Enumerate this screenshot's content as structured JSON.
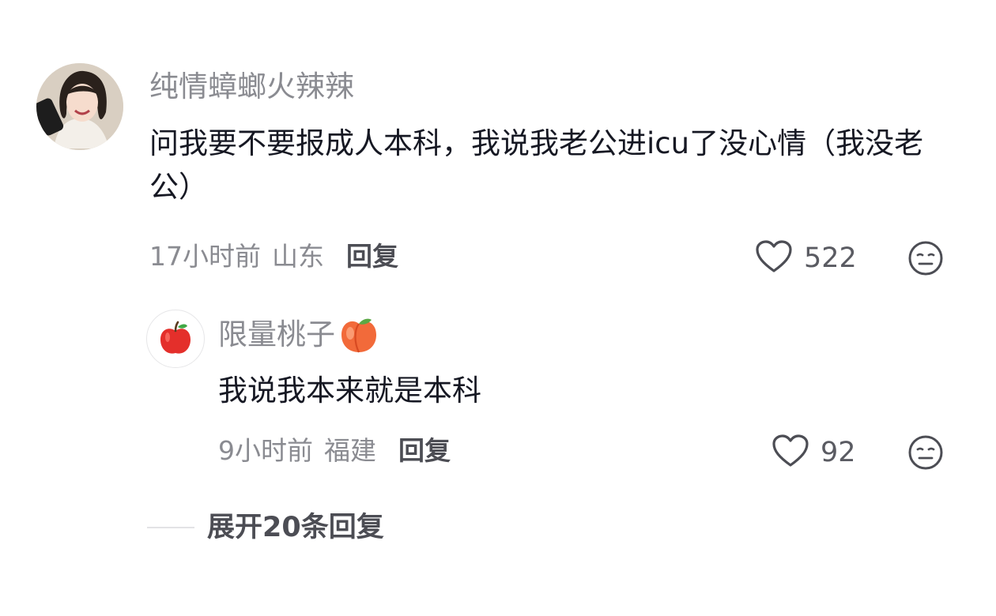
{
  "comment": {
    "username": "纯情蟑螂火辣辣",
    "text": "问我要不要报成人本科，我说我老公进icu了没心情（我没老公）",
    "time": "17小时前",
    "location": "山东",
    "reply_label": "回复",
    "likes": "522"
  },
  "reply": {
    "username": "限量桃子",
    "username_emoji": "peach-emoji",
    "text": "我说我本来就是本科",
    "time": "9小时前",
    "location": "福建",
    "reply_label": "回复",
    "likes": "92"
  },
  "expand_replies": "展开20条回复",
  "colors": {
    "meta": "#8a8b91",
    "text": "#161823",
    "icon": "#4c4d54"
  },
  "icons": [
    "avatar-photo",
    "heart-icon",
    "dislike-face-icon",
    "apple-avatar-icon",
    "peach-emoji"
  ]
}
